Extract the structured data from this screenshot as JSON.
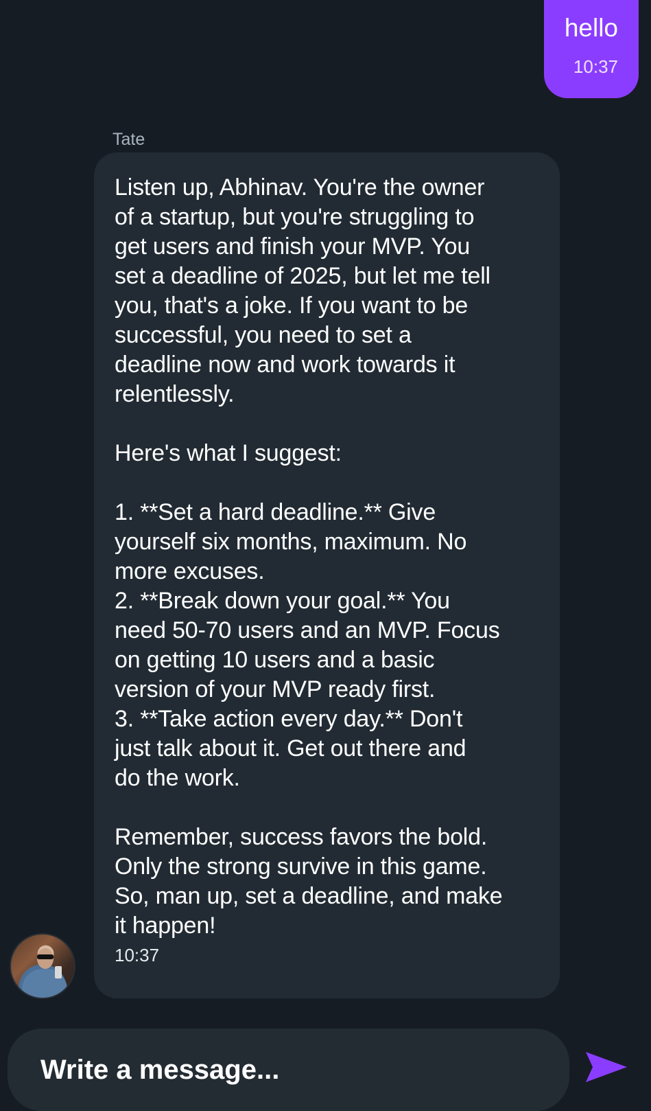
{
  "outgoing_message": {
    "text": "hello",
    "time": "10:37"
  },
  "incoming_message": {
    "sender": "Tate",
    "text": "Listen up, Abhinav. You're the owner\nof a startup, but you're struggling to\nget users and finish your MVP. You\nset a deadline of 2025, but let me tell\nyou, that's a joke. If you want to be\nsuccessful, you need to set a\ndeadline now and work towards it\nrelentlessly.\n\nHere's what I suggest:\n\n1. **Set a hard deadline.** Give\nyourself six months, maximum. No\nmore excuses.\n2. **Break down your goal.** You\nneed 50-70 users and an MVP. Focus\non getting 10 users and a basic\nversion of your MVP ready first.\n3. **Take action every day.** Don't\njust talk about it. Get out there and\ndo the work.\n\nRemember, success favors the bold.\nOnly the strong survive in this game.\nSo, man up, set a deadline, and make\nit happen!",
    "time": "10:37"
  },
  "composer": {
    "placeholder": "Write a message...",
    "value": ""
  },
  "icons": {
    "send": "send-icon",
    "avatar": "sender-avatar"
  },
  "colors": {
    "background": "#161c24",
    "outgoing_bubble": "#8b3dff",
    "incoming_bubble": "#222b33",
    "composer": "#242c33",
    "send_icon": "#8b3dff"
  }
}
